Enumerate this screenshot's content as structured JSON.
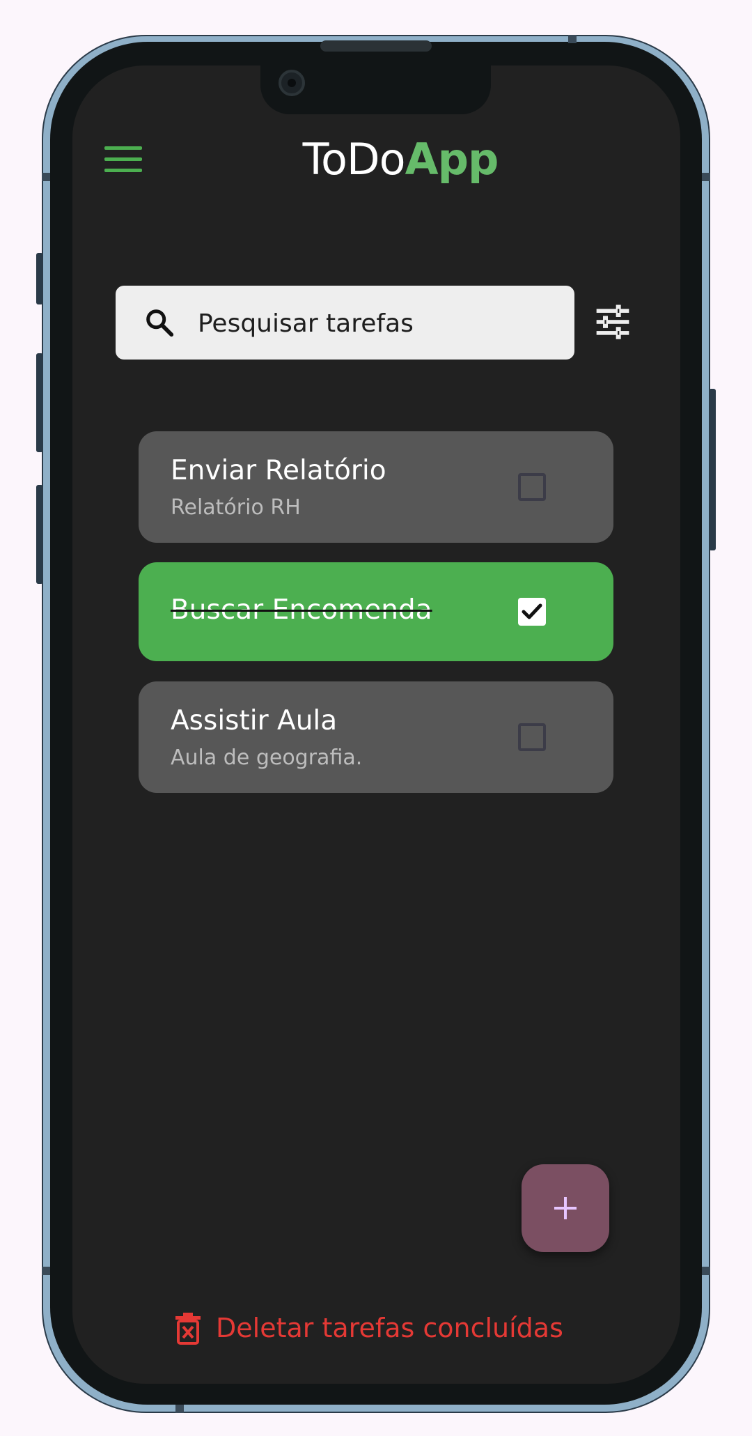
{
  "app": {
    "title_prefix": "ToDo",
    "title_accent": "App",
    "accent_color": "#4caf50"
  },
  "search": {
    "placeholder": "Pesquisar tarefas",
    "value": ""
  },
  "tasks": [
    {
      "title": "Enviar Relatório",
      "description": "Relatório RH",
      "completed": false
    },
    {
      "title": "Buscar Encomenda",
      "description": "",
      "completed": true
    },
    {
      "title": "Assistir Aula",
      "description": "Aula de geografia.",
      "completed": false
    }
  ],
  "icons": {
    "menu": "menu-icon",
    "search": "search-icon",
    "filter": "tune-icon",
    "add": "plus-icon",
    "delete": "trash-icon"
  },
  "actions": {
    "delete_completed_label": "Deletar tarefas concluídas",
    "delete_color": "#e53935",
    "fab_color": "#7b4f62"
  }
}
